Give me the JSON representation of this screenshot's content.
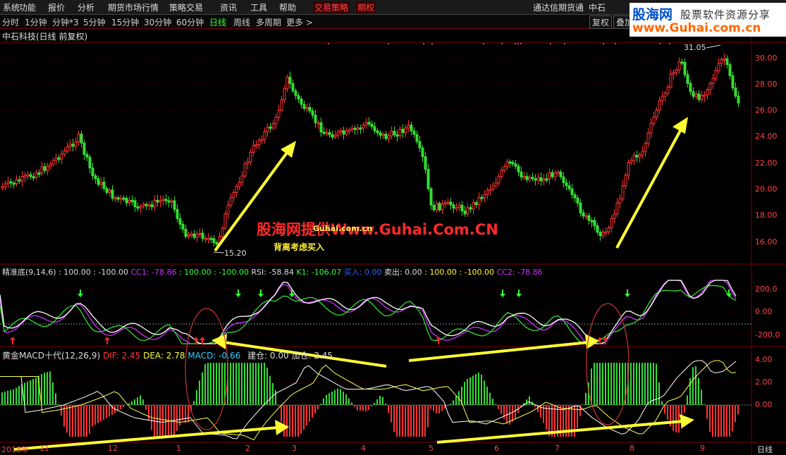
{
  "menu": {
    "items": [
      "系统",
      "功能",
      "报价",
      "分析",
      "期货市场行情",
      "策略交易",
      "资讯",
      "工具",
      "帮助",
      "交易策略",
      "期权"
    ],
    "right_label": "通达信期货通",
    "right_label2": "中石"
  },
  "periods": {
    "items": [
      "分时",
      "1分钟",
      "分钟*3",
      "5分钟",
      "15分钟",
      "30分钟",
      "60分钟",
      "日线",
      "周线",
      "多周期",
      "更多 >"
    ],
    "selected": "日线",
    "right_buttons": [
      "复权",
      "叠加"
    ]
  },
  "logo": {
    "line1a": "股海网",
    "line1b": "股票软件资源分享",
    "line2": "www.Guhai.com.cn"
  },
  "main_panel": {
    "title": "中石科技(日线 前复权)",
    "high_label": "31.05",
    "low_label": "15.20",
    "y_ticks": [
      "30.00",
      "28.00",
      "26.00",
      "24.00",
      "22.00",
      "20.00",
      "18.00",
      "16.00"
    ],
    "watermark": "股海网提供Www.Guhai.Com.CN",
    "note": "背离考虑买入",
    "note_faded": "Guhai.com.cn"
  },
  "ind1": {
    "title": "精准底(9,14,6)",
    "values": [
      ": 100.00",
      ": -100.00",
      "CC1: -78.86",
      ": 100.00",
      ": -100.00",
      "RSI: -58.84",
      "K1: -106.07",
      "买入: 0.00",
      "卖出: 0.00",
      ": 100.00",
      ": -100.00",
      "CC2: -78.86"
    ],
    "y_ticks": [
      "200.0",
      "0.00",
      "-200.0"
    ]
  },
  "ind2": {
    "title": "黄金MACD十代(12,26,9)",
    "values": [
      "DIF: 2.45",
      "DEA: 2.78",
      "MACD: -0.66",
      "建仓: 0.00",
      "加仓: 2.45"
    ],
    "y_ticks": [
      "4.00",
      "2.00",
      "0.00"
    ]
  },
  "x_axis": {
    "labels": [
      "2018年",
      "11",
      "12",
      "1",
      "2",
      "3",
      "4",
      "5",
      "6",
      "7",
      "8",
      "9"
    ],
    "corner": "日线"
  },
  "colors": {
    "up": "#ff3333",
    "down": "#33dd33",
    "arrow": "#ffff33",
    "bg": "#000000"
  }
}
